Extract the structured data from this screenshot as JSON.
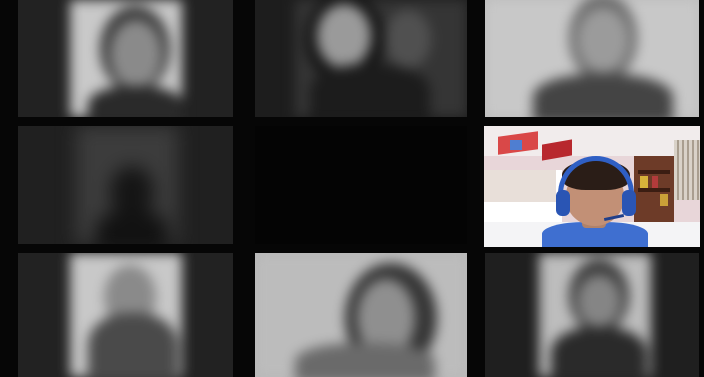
{
  "meeting": {
    "layout": "gallery-3x3",
    "active_speaker_index": 5,
    "participants": [
      {
        "id": "p1",
        "video": "on",
        "blurred": true
      },
      {
        "id": "p2",
        "video": "on",
        "blurred": true
      },
      {
        "id": "p3",
        "video": "on",
        "blurred": true
      },
      {
        "id": "p4",
        "video": "on",
        "blurred": true
      },
      {
        "id": "p5",
        "video": "off",
        "blurred": false
      },
      {
        "id": "p6",
        "video": "on",
        "blurred": false,
        "wearing": "blue headset"
      },
      {
        "id": "p7",
        "video": "on",
        "blurred": true
      },
      {
        "id": "p8",
        "video": "on",
        "blurred": true
      },
      {
        "id": "p9",
        "video": "on",
        "blurred": true
      }
    ]
  },
  "colors": {
    "background": "#060606",
    "tile_gray": "#2a2a2a",
    "headset_blue": "#2f5fc4",
    "room_pink": "#e9d3d6",
    "shirt_blue": "#3f6fd0"
  }
}
